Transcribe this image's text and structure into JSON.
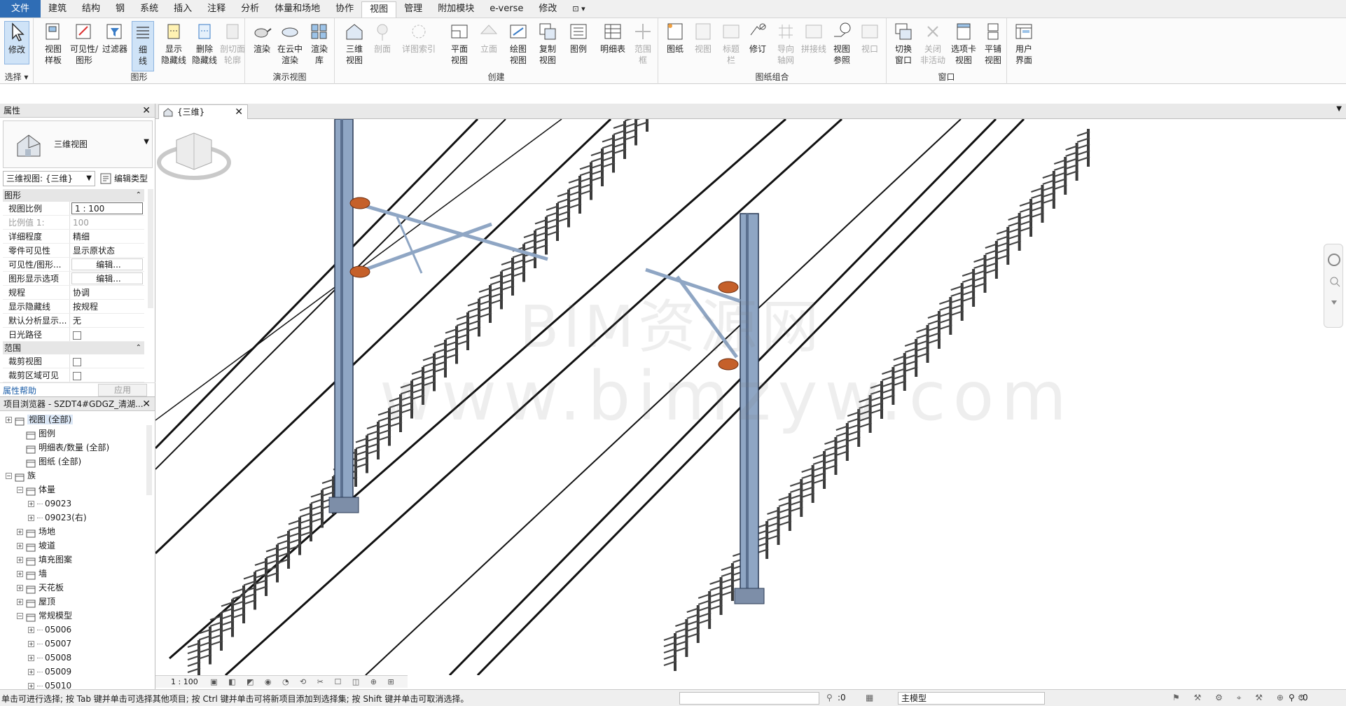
{
  "menu": {
    "tabs": [
      "文件",
      "建筑",
      "结构",
      "钢",
      "系统",
      "插入",
      "注释",
      "分析",
      "体量和场地",
      "协作",
      "视图",
      "管理",
      "附加模块",
      "e-verse",
      "修改"
    ],
    "active": "视图",
    "extra": "⊡ ▾"
  },
  "ribbon": {
    "groups": {
      "select": "选择 ▾",
      "graphics": "图形",
      "presentation": "演示视图",
      "create": "创建",
      "sheet": "图纸组合",
      "window": "窗口"
    },
    "buttons": {
      "modify": "修改",
      "view_template": "视图\n样板",
      "vis_graphics": "可见性/\n图形",
      "filters": "过滤器",
      "thin_lines": "细\n线",
      "show_hidden": "显示\n隐藏线",
      "remove_hidden": "删除\n隐藏线",
      "cut_profile": "剖切面\n轮廓",
      "render": "渲染",
      "render_cloud": "在云中\n渲染",
      "render_gallery": "渲染\n库",
      "view3d": "三维\n视图",
      "section": "剖面",
      "callout": "详图索引",
      "plan_views": "平面\n视图",
      "elevation": "立面",
      "drafting_view": "绘图\n视图",
      "duplicate_view": "复制\n视图",
      "legends": "图例",
      "schedules": "明细表",
      "scope_box": "范围\n框",
      "sheet": "图纸",
      "view": "视图",
      "title_block": "标题\n栏",
      "revisions": "修订",
      "guide_grid": "导向\n轴网",
      "matchline": "拼接线",
      "view_ref": "视图\n参照",
      "viewports": "视口",
      "switch_windows": "切换\n窗口",
      "close_inactive": "关闭\n非活动",
      "tab_views": "选项卡\n视图",
      "tile_views": "平铺\n视图",
      "user_interface": "用户\n界面"
    }
  },
  "doc_tab": {
    "label": "{三维}",
    "close": "✕"
  },
  "properties": {
    "title": "属性",
    "close": "✕",
    "type_name": "三维视图",
    "selector": "三维视图: {三维}",
    "edit_type": "编辑类型",
    "sections": {
      "graphics": "图形",
      "extents": "范围"
    },
    "rows": [
      {
        "k": "视图比例",
        "v": "1 : 100",
        "style": "box"
      },
      {
        "k": "比例值 1:",
        "v": "100",
        "style": "dim"
      },
      {
        "k": "详细程度",
        "v": "精细",
        "style": ""
      },
      {
        "k": "零件可见性",
        "v": "显示原状态",
        "style": ""
      },
      {
        "k": "可见性/图形...",
        "v": "编辑...",
        "style": "btn"
      },
      {
        "k": "图形显示选项",
        "v": "编辑...",
        "style": "btn"
      },
      {
        "k": "规程",
        "v": "协调",
        "style": ""
      },
      {
        "k": "显示隐藏线",
        "v": "按规程",
        "style": ""
      },
      {
        "k": "默认分析显示...",
        "v": "无",
        "style": ""
      },
      {
        "k": "日光路径",
        "v": "",
        "style": "check"
      }
    ],
    "extent_rows": [
      {
        "k": "裁剪视图",
        "v": "",
        "style": "check"
      },
      {
        "k": "裁剪区域可见",
        "v": "",
        "style": "check"
      }
    ],
    "help": "属性帮助",
    "apply": "应用"
  },
  "browser": {
    "title": "项目浏览器 - SZDT4#GDGZ_清湖...",
    "close": "✕",
    "nodes": [
      {
        "label": "视图 (全部)",
        "level": 0,
        "exp": "+",
        "sel": true
      },
      {
        "label": "图例",
        "level": 1,
        "exp": "",
        "sel": false
      },
      {
        "label": "明细表/数量 (全部)",
        "level": 1,
        "exp": "",
        "sel": false
      },
      {
        "label": "图纸 (全部)",
        "level": 1,
        "exp": "",
        "sel": false
      },
      {
        "label": "族",
        "level": 0,
        "exp": "-",
        "sel": false
      },
      {
        "label": "体量",
        "level": 1,
        "exp": "-",
        "sel": false
      },
      {
        "label": "09023",
        "level": 2,
        "exp": "+",
        "sel": false
      },
      {
        "label": "09023(右)",
        "level": 2,
        "exp": "+",
        "sel": false
      },
      {
        "label": "场地",
        "level": 1,
        "exp": "+",
        "sel": false
      },
      {
        "label": "坡道",
        "level": 1,
        "exp": "+",
        "sel": false
      },
      {
        "label": "填充图案",
        "level": 1,
        "exp": "+",
        "sel": false
      },
      {
        "label": "墙",
        "level": 1,
        "exp": "+",
        "sel": false
      },
      {
        "label": "天花板",
        "level": 1,
        "exp": "+",
        "sel": false
      },
      {
        "label": "屋顶",
        "level": 1,
        "exp": "+",
        "sel": false
      },
      {
        "label": "常规模型",
        "level": 1,
        "exp": "-",
        "sel": false
      },
      {
        "label": "05006",
        "level": 2,
        "exp": "+",
        "sel": false
      },
      {
        "label": "05007",
        "level": 2,
        "exp": "+",
        "sel": false
      },
      {
        "label": "05008",
        "level": 2,
        "exp": "+",
        "sel": false
      },
      {
        "label": "05009",
        "level": 2,
        "exp": "+",
        "sel": false
      },
      {
        "label": "05010",
        "level": 2,
        "exp": "+",
        "sel": false
      }
    ]
  },
  "canvas": {
    "watermark1": "BIM资源网",
    "watermark2": "www.bimzyw.com"
  },
  "viewbar": {
    "scale": "1 : 100"
  },
  "status": {
    "message": "单击可进行选择; 按 Tab 键并单击可选择其他项目; 按 Ctrl 键并单击可将新项目添加到选择集; 按 Shift 键并单击可取消选择。",
    "count": ":0",
    "model": "主模型",
    "filter_count": ":0"
  },
  "colors": {
    "accent": "#2f6db5",
    "ribbon_bg": "#fbfbfb",
    "steel": "#8fa6c4",
    "insulator": "#c5602a"
  }
}
